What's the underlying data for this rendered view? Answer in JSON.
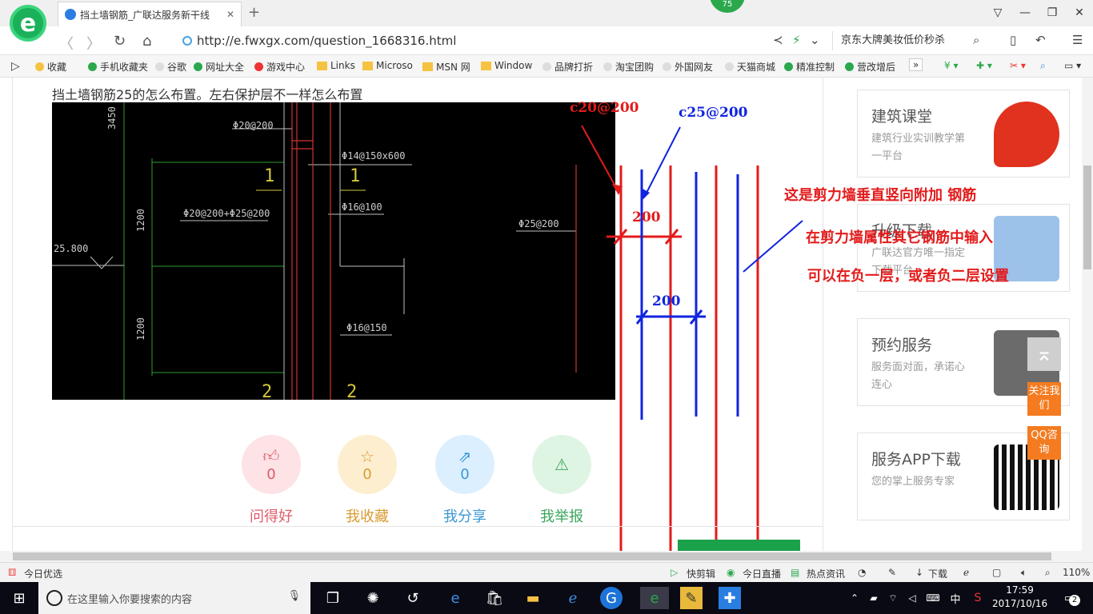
{
  "browser": {
    "tab_title": "挡土墙钢筋_广联达服务新干线",
    "new_tab": "+",
    "badge": "75",
    "window_controls": [
      "▽",
      "—",
      "❐",
      "✕"
    ],
    "back": "〈",
    "forward": "〉",
    "reload": "↻",
    "home": "⌂",
    "url": "http://e.fwxgx.com/question_1668316.html",
    "search_text": "京东大牌美妆低价秒杀"
  },
  "bookmarks": [
    {
      "label": "收藏",
      "icon": "star-icon"
    },
    {
      "label": "手机收藏夹",
      "icon": "phone-icon"
    },
    {
      "label": "谷歌",
      "icon": "page-icon"
    },
    {
      "label": "网址大全",
      "icon": "globe-icon"
    },
    {
      "label": "游戏中心",
      "icon": "game-icon"
    },
    {
      "label": "Links",
      "icon": "folder-icon"
    },
    {
      "label": "Microso",
      "icon": "folder-icon"
    },
    {
      "label": "MSN 网",
      "icon": "folder-icon"
    },
    {
      "label": "Window",
      "icon": "folder-icon"
    },
    {
      "label": "品牌打折",
      "icon": "page-icon"
    },
    {
      "label": "淘宝团购",
      "icon": "page-icon"
    },
    {
      "label": "外国网友",
      "icon": "page-icon"
    },
    {
      "label": "天猫商城",
      "icon": "page-icon"
    },
    {
      "label": "精准控制",
      "icon": "chat-icon"
    },
    {
      "label": "营改增后",
      "icon": "chat-icon"
    }
  ],
  "question": {
    "title": "挡土墙钢筋25的怎么布置。左右保护层不一样怎么布置"
  },
  "cad": {
    "labels": [
      "Φ20@200",
      "Φ14@150x600",
      "Φ20@200+Φ25@200",
      "Φ16@100",
      "Φ25@200",
      "Φ16@150",
      "25.800",
      "1200",
      "1200",
      "3450",
      "1",
      "1",
      "2",
      "2"
    ]
  },
  "annotations": {
    "red_spec": "c20@200",
    "blue_spec": "c25@200",
    "red_dim": "200",
    "blue_dim": "200",
    "note1": "这是剪力墙垂直竖向附加 钢筋",
    "note2": "在剪力墙属性其它钢筋中输入",
    "note3": "可以在负一层，或者负二层设置"
  },
  "actions": [
    {
      "label": "问得好",
      "count": "0",
      "icon": "thumbs-up-icon",
      "color": "#e05a6a",
      "bg": "#fde3e6"
    },
    {
      "label": "我收藏",
      "count": "0",
      "icon": "star-icon",
      "color": "#d99b2f",
      "bg": "#fdeecf"
    },
    {
      "label": "我分享",
      "count": "0",
      "icon": "share-icon",
      "color": "#3a97d4",
      "bg": "#dcefff"
    },
    {
      "label": "我举报",
      "count": "",
      "icon": "warning-icon",
      "color": "#3aa55c",
      "bg": "#dff5e4"
    }
  ],
  "sidebar": [
    {
      "title": "建筑课堂",
      "desc": "建筑行业实训教学第一平台"
    },
    {
      "title": "升级下载",
      "desc": "广联达官方唯一指定下载平台"
    },
    {
      "title": "预约服务",
      "desc": "服务面对面，承诺心连心"
    },
    {
      "title": "服务APP下载",
      "desc": "您的掌上服务专家"
    }
  ],
  "float_buttons": [
    "关注我们",
    "QQ咨询"
  ],
  "statusbar": {
    "left": "今日优选",
    "items": [
      "快剪辑",
      "今日直播",
      "热点资讯",
      "下载"
    ],
    "zoom": "110%"
  },
  "taskbar": {
    "search_placeholder": "在这里输入你要搜索的内容",
    "ime": "中",
    "time": "17:59",
    "date": "2017/10/16",
    "notif": "2"
  }
}
